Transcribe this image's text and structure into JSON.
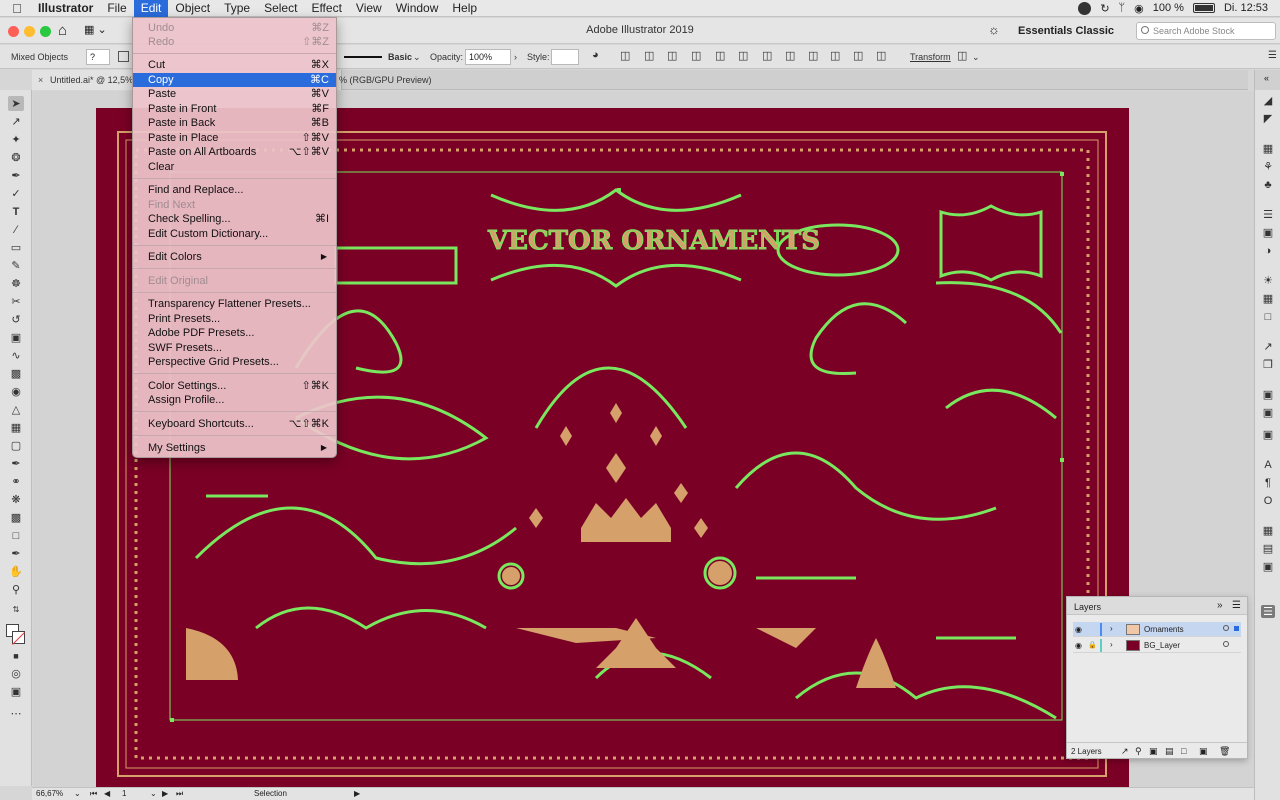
{
  "menubar": {
    "items": [
      {
        "label": "Illustrator"
      },
      {
        "label": "File"
      },
      {
        "label": "Edit"
      },
      {
        "label": "Object"
      },
      {
        "label": "Type"
      },
      {
        "label": "Select"
      },
      {
        "label": "Effect"
      },
      {
        "label": "View"
      },
      {
        "label": "Window"
      },
      {
        "label": "Help"
      }
    ],
    "battery": "100 %",
    "clock": "Di. 12:53"
  },
  "app": {
    "title": "Adobe Illustrator 2019",
    "workspace": "Essentials Classic",
    "search_placeholder": "Search Adobe Stock"
  },
  "control_bar": {
    "selection_type": "Mixed Objects",
    "stroke_style": "Basic",
    "opacity_label": "Opacity:",
    "opacity_value": "100%",
    "style_label": "Style:",
    "transform_label": "Transform"
  },
  "document": {
    "tab_name": "Untitled.ai* @ 12,5%",
    "tab_mode": "% (RGB/GPU Preview)",
    "artwork_title": "VECTOR ORNAMENTS"
  },
  "edit_menu": {
    "items": [
      {
        "label": "Undo",
        "shortcut": "⌘Z"
      },
      {
        "label": "Redo",
        "shortcut": "⇧⌘Z"
      },
      {
        "label": "Cut",
        "shortcut": "⌘X"
      },
      {
        "label": "Copy",
        "shortcut": "⌘C"
      },
      {
        "label": "Paste",
        "shortcut": "⌘V"
      },
      {
        "label": "Paste in Front",
        "shortcut": "⌘F"
      },
      {
        "label": "Paste in Back",
        "shortcut": "⌘B"
      },
      {
        "label": "Paste in Place",
        "shortcut": "⇧⌘V"
      },
      {
        "label": "Paste on All Artboards",
        "shortcut": "⌥⇧⌘V"
      },
      {
        "label": "Clear",
        "shortcut": ""
      },
      {
        "label": "Find and Replace...",
        "shortcut": ""
      },
      {
        "label": "Find Next",
        "shortcut": ""
      },
      {
        "label": "Check Spelling...",
        "shortcut": "⌘I"
      },
      {
        "label": "Edit Custom Dictionary...",
        "shortcut": ""
      },
      {
        "label": "Edit Colors",
        "shortcut": ""
      },
      {
        "label": "Edit Original",
        "shortcut": ""
      },
      {
        "label": "Transparency Flattener Presets...",
        "shortcut": ""
      },
      {
        "label": "Print Presets...",
        "shortcut": ""
      },
      {
        "label": "Adobe PDF Presets...",
        "shortcut": ""
      },
      {
        "label": "SWF Presets...",
        "shortcut": ""
      },
      {
        "label": "Perspective Grid Presets...",
        "shortcut": ""
      },
      {
        "label": "Color Settings...",
        "shortcut": "⇧⌘K"
      },
      {
        "label": "Assign Profile...",
        "shortcut": ""
      },
      {
        "label": "Keyboard Shortcuts...",
        "shortcut": "⌥⇧⌘K"
      },
      {
        "label": "My Settings",
        "shortcut": ""
      }
    ]
  },
  "layers_panel": {
    "title": "Layers",
    "layers": [
      {
        "name": "Ornaments",
        "color": "#4a8cf0"
      },
      {
        "name": "BG_Layer",
        "color": "#5ad0c0"
      }
    ],
    "count": "2 Layers"
  },
  "status_bar": {
    "zoom": "66,67%",
    "artboard": "1",
    "tool": "Selection"
  },
  "colors": {
    "artboard_bg": "#7a0025",
    "ornament_fill": "#d5a06a",
    "selection_highlight": "#79e85e",
    "menu_highlight": "#2a6cdc"
  }
}
